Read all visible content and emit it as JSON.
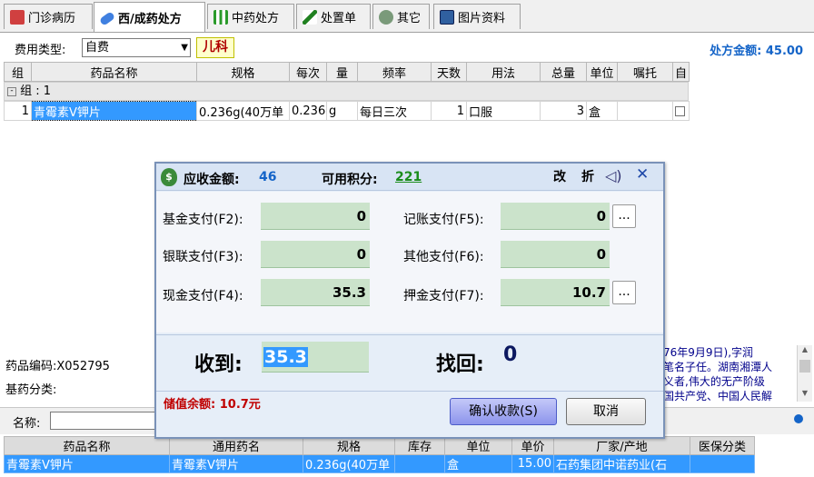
{
  "tabs": [
    {
      "label": "门诊病历",
      "icon": "medical-record-icon"
    },
    {
      "label": "西/成药处方",
      "icon": "pill-icon"
    },
    {
      "label": "中药处方",
      "icon": "herb-icon"
    },
    {
      "label": "处置单",
      "icon": "syringe-icon"
    },
    {
      "label": "其它",
      "icon": "circle-icon"
    },
    {
      "label": "图片资料",
      "icon": "image-icon"
    }
  ],
  "toolbar": {
    "fee_type_label": "费用类型:",
    "fee_type_value": "自费",
    "dept_tag": "儿科",
    "rx_amount_label": "处方金额:",
    "rx_amount_value": "45.00"
  },
  "grid": {
    "headers": [
      "组",
      "药品名称",
      "规格",
      "每次",
      "量",
      "频率",
      "天数",
      "用法",
      "总量",
      "单位",
      "嘱托",
      "自"
    ],
    "group_label": "组 : 1",
    "rows": [
      {
        "group": "1",
        "name": "青霉素V钾片",
        "spec": "0.236g(40万单",
        "dose": "0.236",
        "unit": "g",
        "freq": "每日三次",
        "days": "1",
        "usage": "口服",
        "total": "3",
        "total_unit": "盒",
        "note": ""
      }
    ]
  },
  "drug_info": {
    "code_label": "药品编码:",
    "code_value": "X052795",
    "class_label": "基药分类:"
  },
  "hint_text": "76年9月9日),字润\n笔名子任。湖南湘潭人\n义者,伟大的无产阶级\n国共产党、中国人民解",
  "search": {
    "label": "名称:"
  },
  "results": {
    "headers": [
      "药品名称",
      "通用药名",
      "规格",
      "库存",
      "单位",
      "单价",
      "厂家/产地",
      "医保分类"
    ],
    "rows": [
      {
        "name": "青霉素V钾片",
        "generic": "青霉素V钾片",
        "spec": "0.236g(40万单",
        "stock": "",
        "unit": "盒",
        "price": "15.00",
        "maker": "石药集团中诺药业(石",
        "insurance": ""
      }
    ]
  },
  "modal": {
    "receivable_label": "应收金额:",
    "receivable_value": "46",
    "points_label": "可用积分:",
    "points_value": "221",
    "modify_label": "改",
    "discount_label": "折",
    "payments": [
      {
        "label": "基金支付(F2):",
        "value": "0"
      },
      {
        "label": "记账支付(F5):",
        "value": "0"
      },
      {
        "label": "银联支付(F3):",
        "value": "0"
      },
      {
        "label": "其他支付(F6):",
        "value": "0"
      },
      {
        "label": "现金支付(F4):",
        "value": "35.3"
      },
      {
        "label": "押金支付(F7):",
        "value": "10.7"
      }
    ],
    "received_label": "收到:",
    "received_value": "35.3",
    "change_label": "找回:",
    "change_value": "0",
    "balance_text": "储值余额: 10.7元",
    "confirm_label": "确认收款(S)",
    "cancel_label": "取消",
    "colors": {
      "accent_blue": "#1464c8",
      "green_value": "#1a8c1a",
      "red_text": "#c00000"
    }
  }
}
